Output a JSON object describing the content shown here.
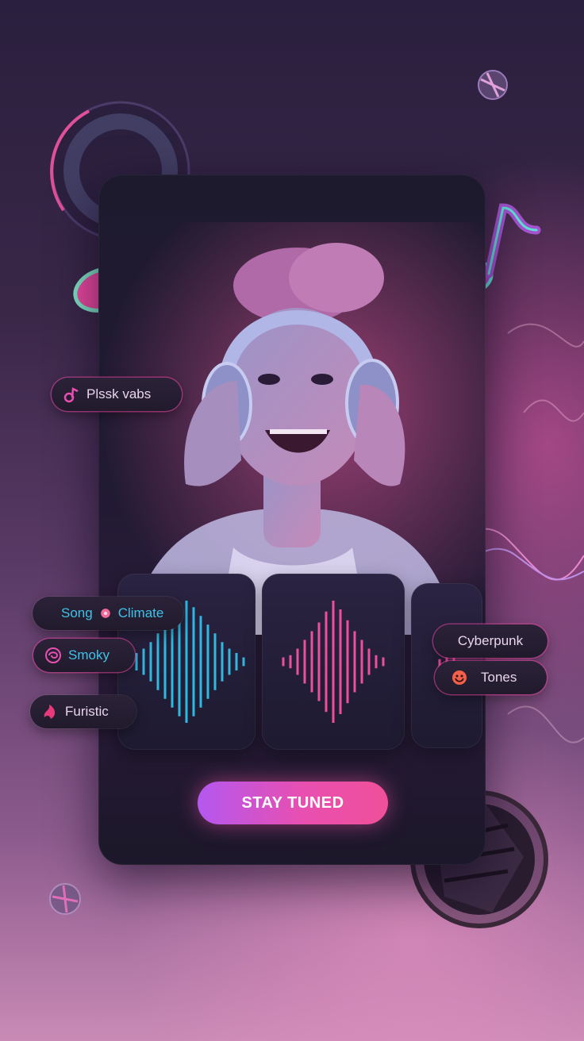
{
  "colors": {
    "accent_pink": "#e84fb0",
    "accent_cyan": "#3fc2e8",
    "accent_purple": "#b458f0",
    "card_bg": "#1e1a2e"
  },
  "cta": {
    "label": "STAY TUNED"
  },
  "chips": {
    "left_top": {
      "label": "Plssk vabs",
      "icon": "music-note-icon"
    },
    "song": {
      "label": "Song"
    },
    "climate": {
      "label": "Climate",
      "icon": "record-dot-icon"
    },
    "smoky": {
      "label": "Smoky",
      "icon": "spiral-icon"
    },
    "furistic": {
      "label": "Furistic",
      "icon": "flame-icon"
    },
    "cyberpunk": {
      "label": "Cyberpunk"
    },
    "tones": {
      "label": "Tones",
      "icon": "smiley-icon"
    }
  },
  "wave_panels": [
    {
      "name": "waveform-cyan",
      "color": "#2fb8e0",
      "bars": [
        2,
        4,
        6,
        9,
        13,
        17,
        21,
        25,
        28,
        25,
        21,
        17,
        13,
        9,
        6,
        4,
        2
      ]
    },
    {
      "name": "waveform-pink",
      "color": "#ec4f9e",
      "bars": [
        2,
        3,
        6,
        10,
        14,
        18,
        23,
        28,
        24,
        19,
        14,
        10,
        6,
        3,
        2
      ]
    },
    {
      "name": "waveform-partial",
      "color": "#ec4f9e",
      "bars": [
        3,
        7,
        12
      ]
    }
  ]
}
